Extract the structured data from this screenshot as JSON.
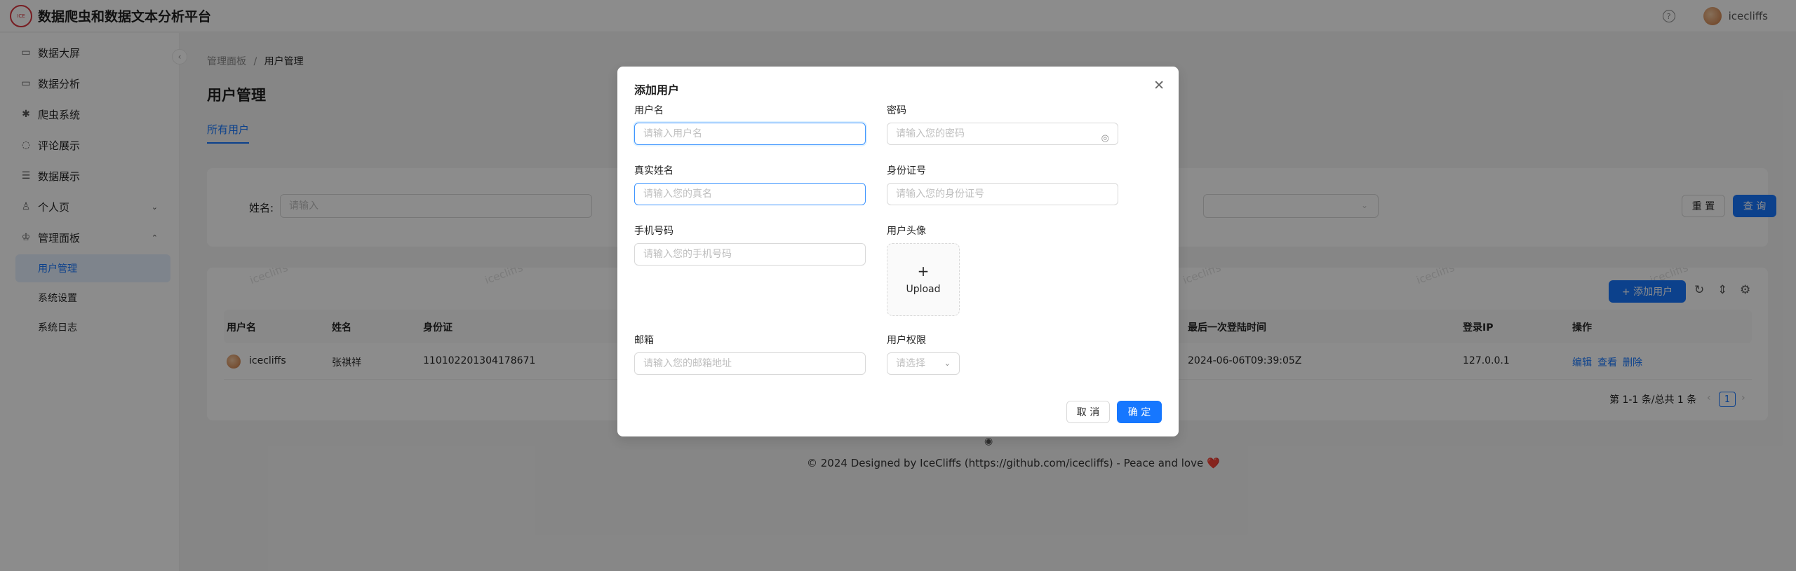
{
  "app": {
    "title": "数据爬虫和数据文本分析平台",
    "logo_text": "ICE"
  },
  "header": {
    "help_icon": "question-circle-icon",
    "user": "icecliffs"
  },
  "sidebar": {
    "items": [
      {
        "label": "数据大屏",
        "icon": "monitor-icon"
      },
      {
        "label": "数据分析",
        "icon": "chart-icon"
      },
      {
        "label": "爬虫系统",
        "icon": "bug-icon"
      },
      {
        "label": "评论展示",
        "icon": "comment-icon"
      },
      {
        "label": "数据展示",
        "icon": "database-icon"
      },
      {
        "label": "个人页",
        "icon": "user-icon"
      },
      {
        "label": "管理面板",
        "icon": "crown-icon"
      }
    ],
    "sub_items": [
      {
        "label": "用户管理",
        "active": true
      },
      {
        "label": "系统设置",
        "active": false
      },
      {
        "label": "系统日志",
        "active": false
      }
    ]
  },
  "breadcrumb": {
    "parent": "管理面板",
    "separator": "/",
    "current": "用户管理"
  },
  "page": {
    "title": "用户管理",
    "tab": "所有用户"
  },
  "search": {
    "label": "姓名:",
    "placeholder": "请输入",
    "reset": "重 置",
    "query": "查 询"
  },
  "table": {
    "add_button": "+ 添加用户",
    "watermark": "icecliffs",
    "headers": [
      "用户名",
      "姓名",
      "身份证",
      "最后一次登陆时间",
      "登录IP",
      "操作"
    ],
    "rows": [
      {
        "username": "icecliffs",
        "name": "张祺祥",
        "id_card": "110102201304178671",
        "last_login": "2024-06-06T09:39:05Z",
        "ip": "127.0.0.1",
        "actions": [
          "编辑",
          "查看",
          "删除"
        ]
      }
    ],
    "pagination": {
      "summary": "第 1-1 条/总共 1 条",
      "page": "1"
    }
  },
  "footer": {
    "text": "© 2024 Designed by IceCliffs (https://github.com/icecliffs) - Peace and love ❤️"
  },
  "modal": {
    "title": "添加用户",
    "fields": {
      "username": {
        "label": "用户名",
        "placeholder": "请输入用户名"
      },
      "password": {
        "label": "密码",
        "placeholder": "请输入您的密码"
      },
      "realname": {
        "label": "真实姓名",
        "placeholder": "请输入您的真名"
      },
      "idcard": {
        "label": "身份证号",
        "placeholder": "请输入您的身份证号"
      },
      "phone": {
        "label": "手机号码",
        "placeholder": "请输入您的手机号码"
      },
      "avatar": {
        "label": "用户头像",
        "upload": "Upload"
      },
      "email": {
        "label": "邮箱",
        "placeholder": "请输入您的邮箱地址"
      },
      "permission": {
        "label": "用户权限",
        "placeholder": "请选择"
      }
    },
    "cancel": "取 消",
    "ok": "确 定"
  }
}
